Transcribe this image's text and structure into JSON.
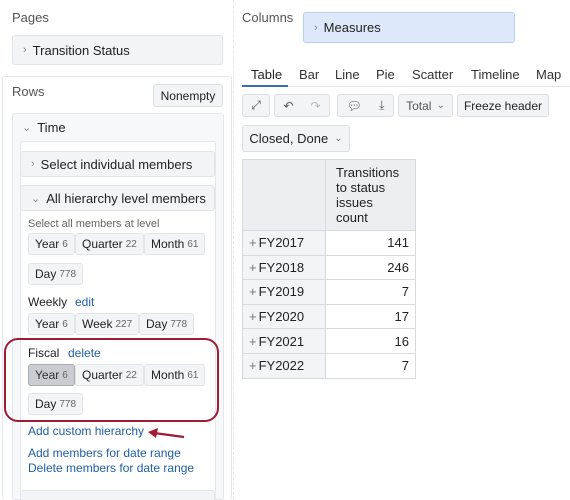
{
  "pages": {
    "title": "Pages",
    "item": "Transition Status"
  },
  "rows": {
    "title": "Rows",
    "nonempty_label": "Nonempty",
    "time": {
      "label": "Time",
      "select_individual": "Select individual members",
      "all_hierarchy": "All hierarchy level members",
      "select_all_at_level": "Select all members at level",
      "default_levels": [
        {
          "name": "Year",
          "count": "6"
        },
        {
          "name": "Quarter",
          "count": "22"
        },
        {
          "name": "Month",
          "count": "61"
        },
        {
          "name": "Day",
          "count": "778"
        }
      ],
      "weekly": {
        "label": "Weekly",
        "action": "edit",
        "levels": [
          {
            "name": "Year",
            "count": "6"
          },
          {
            "name": "Week",
            "count": "227"
          },
          {
            "name": "Day",
            "count": "778"
          }
        ]
      },
      "fiscal": {
        "label": "Fiscal",
        "action": "delete",
        "levels": [
          {
            "name": "Year",
            "count": "6"
          },
          {
            "name": "Quarter",
            "count": "22"
          },
          {
            "name": "Month",
            "count": "61"
          },
          {
            "name": "Day",
            "count": "778"
          }
        ]
      },
      "add_custom_hierarchy": "Add custom hierarchy",
      "add_members_date_range": "Add members for date range",
      "delete_members_date_range": "Delete members for date range"
    }
  },
  "columns": {
    "title": "Columns",
    "item": "Measures"
  },
  "tabs": [
    "Table",
    "Bar",
    "Line",
    "Pie",
    "Scatter",
    "Timeline",
    "Map"
  ],
  "active_tab": "Table",
  "toolbar": {
    "total_label": "Total",
    "freeze_label": "Freeze header"
  },
  "filter": {
    "label": "Closed, Done"
  },
  "table": {
    "header": "Transitions to status issues count",
    "header_lines": [
      "Transitions",
      "to status",
      "issues",
      "count"
    ],
    "rows": [
      {
        "label": "FY2017",
        "value": "141"
      },
      {
        "label": "FY2018",
        "value": "246"
      },
      {
        "label": "FY2019",
        "value": "7"
      },
      {
        "label": "FY2020",
        "value": "17"
      },
      {
        "label": "FY2021",
        "value": "16"
      },
      {
        "label": "FY2022",
        "value": "7"
      }
    ]
  },
  "colors": {
    "accent": "#3a6fb0",
    "link": "#1f5fa8",
    "highlight": "#a01c34",
    "measures_bg": "#dde9fb"
  }
}
